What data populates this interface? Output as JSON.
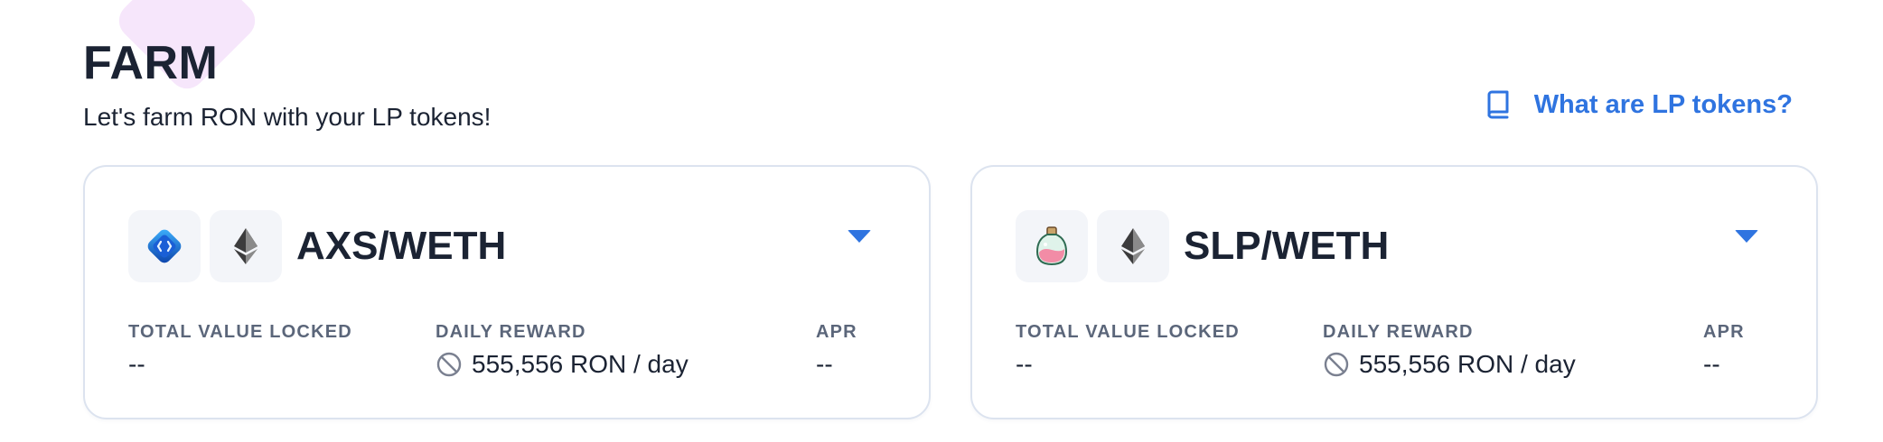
{
  "header": {
    "title": "FARM",
    "subtitle": "Let's farm RON with your LP tokens!",
    "help_link": "What are LP tokens?"
  },
  "farms": [
    {
      "pair": "AXS/WETH",
      "token_icons": [
        "axs-icon",
        "eth-icon"
      ],
      "stats": {
        "tvl_label": "TOTAL VALUE LOCKED",
        "tvl_value": "--",
        "reward_label": "DAILY REWARD",
        "reward_value": "555,556 RON / day",
        "apr_label": "APR",
        "apr_value": "--"
      }
    },
    {
      "pair": "SLP/WETH",
      "token_icons": [
        "slp-icon",
        "eth-icon"
      ],
      "stats": {
        "tvl_label": "TOTAL VALUE LOCKED",
        "tvl_value": "--",
        "reward_label": "DAILY REWARD",
        "reward_value": "555,556 RON / day",
        "apr_label": "APR",
        "apr_value": "--"
      }
    }
  ],
  "colors": {
    "accent": "#2f74e0",
    "text": "#1b2333",
    "muted": "#5b667a",
    "card_border": "#dce3ef",
    "token_bg": "#f3f5f9",
    "decoration": "#f6e6fb"
  }
}
